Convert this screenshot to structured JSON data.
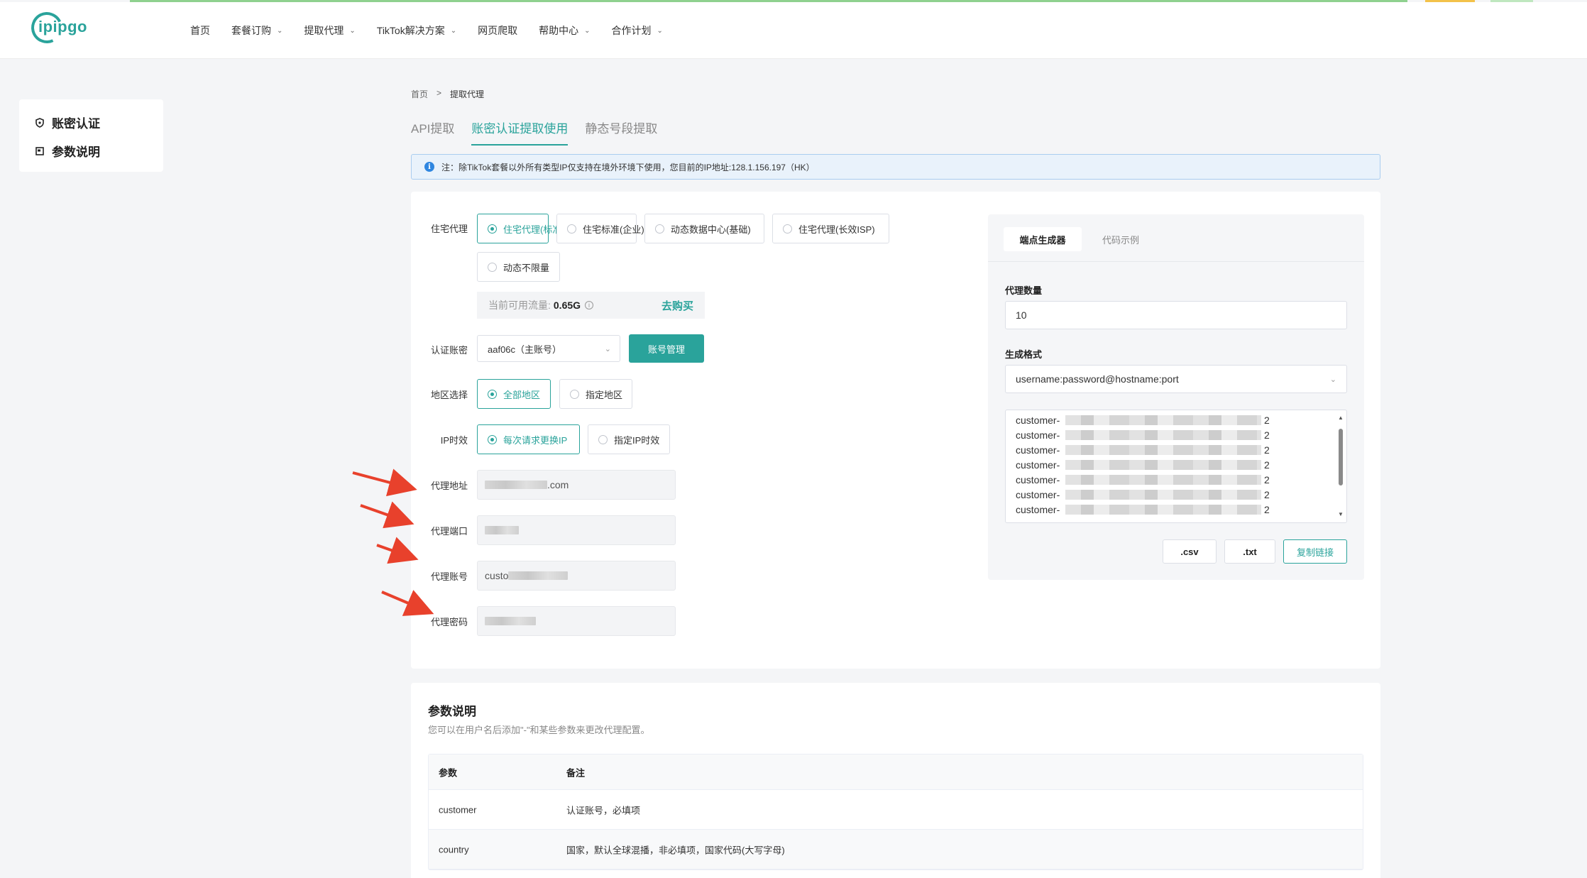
{
  "brand": {
    "logo_text": "ipipgo",
    "accent": "#2aa39b"
  },
  "nav": [
    {
      "label": "首页",
      "dropdown": false
    },
    {
      "label": "套餐订购",
      "dropdown": true
    },
    {
      "label": "提取代理",
      "dropdown": true
    },
    {
      "label": "TikTok解决方案",
      "dropdown": true
    },
    {
      "label": "网页爬取",
      "dropdown": false
    },
    {
      "label": "帮助中心",
      "dropdown": true
    },
    {
      "label": "合作计划",
      "dropdown": true
    }
  ],
  "sidebar": {
    "items": [
      {
        "label": "账密认证",
        "icon": "shield-icon"
      },
      {
        "label": "参数说明",
        "icon": "book-icon"
      }
    ]
  },
  "breadcrumb": {
    "home": "首页",
    "sep": ">",
    "current": "提取代理"
  },
  "tabs": [
    {
      "label": "API提取",
      "active": false
    },
    {
      "label": "账密认证提取使用",
      "active": true
    },
    {
      "label": "静态号段提取",
      "active": false
    }
  ],
  "notice": {
    "icon": "i",
    "text": "注：除TikTok套餐以外所有类型IP仅支持在境外环境下使用，您目前的IP地址:128.1.156.197（HK）"
  },
  "form": {
    "proxy_type_label": "住宅代理",
    "proxy_types": [
      {
        "label": "住宅代理(标准)",
        "selected": true
      },
      {
        "label": "住宅标准(企业)",
        "selected": false
      },
      {
        "label": "动态数据中心(基础)",
        "selected": false
      },
      {
        "label": "住宅代理(长效ISP)",
        "selected": false
      },
      {
        "label": "动态不限量",
        "selected": false
      }
    ],
    "traffic_label": "当前可用流量:",
    "traffic_value": "0.65G",
    "buy_label": "去购买",
    "account_label": "认证账密",
    "account_value": "aaf06c（主账号）",
    "account_manage": "账号管理",
    "region_label": "地区选择",
    "regions": [
      {
        "label": "全部地区",
        "selected": true
      },
      {
        "label": "指定地区",
        "selected": false
      }
    ],
    "ip_time_label": "IP时效",
    "ip_times": [
      {
        "label": "每次请求更换IP",
        "selected": true
      },
      {
        "label": "指定IP时效",
        "selected": false
      }
    ],
    "address_label": "代理地址",
    "address_suffix": ".com",
    "port_label": "代理端口",
    "user_label": "代理账号",
    "user_prefix": "custo",
    "pass_label": "代理密码"
  },
  "generator": {
    "tabs": [
      {
        "label": "端点生成器",
        "active": true
      },
      {
        "label": "代码示例",
        "active": false
      }
    ],
    "qty_label": "代理数量",
    "qty_value": "10",
    "format_label": "生成格式",
    "format_value": "username:password@hostname:port",
    "lines": [
      {
        "prefix": "customer-",
        "suffix": "2"
      },
      {
        "prefix": "customer-",
        "suffix": "2"
      },
      {
        "prefix": "customer-",
        "suffix": "2"
      },
      {
        "prefix": "customer-",
        "suffix": "2"
      },
      {
        "prefix": "customer-",
        "suffix": "2"
      },
      {
        "prefix": "customer-",
        "suffix": "2"
      },
      {
        "prefix": "customer-",
        "suffix": "2"
      }
    ],
    "btn_csv": ".csv",
    "btn_txt": ".txt",
    "btn_copy": "复制链接"
  },
  "params": {
    "title": "参数说明",
    "subtitle": "您可以在用户名后添加\"-\"和某些参数来更改代理配置。",
    "head": {
      "c1": "参数",
      "c2": "备注"
    },
    "rows": [
      {
        "c1": "customer",
        "c2": "认证账号，必填项"
      },
      {
        "c1": "country",
        "c2": "国家，默认全球混播，非必填项，国家代码(大写字母)"
      }
    ]
  }
}
